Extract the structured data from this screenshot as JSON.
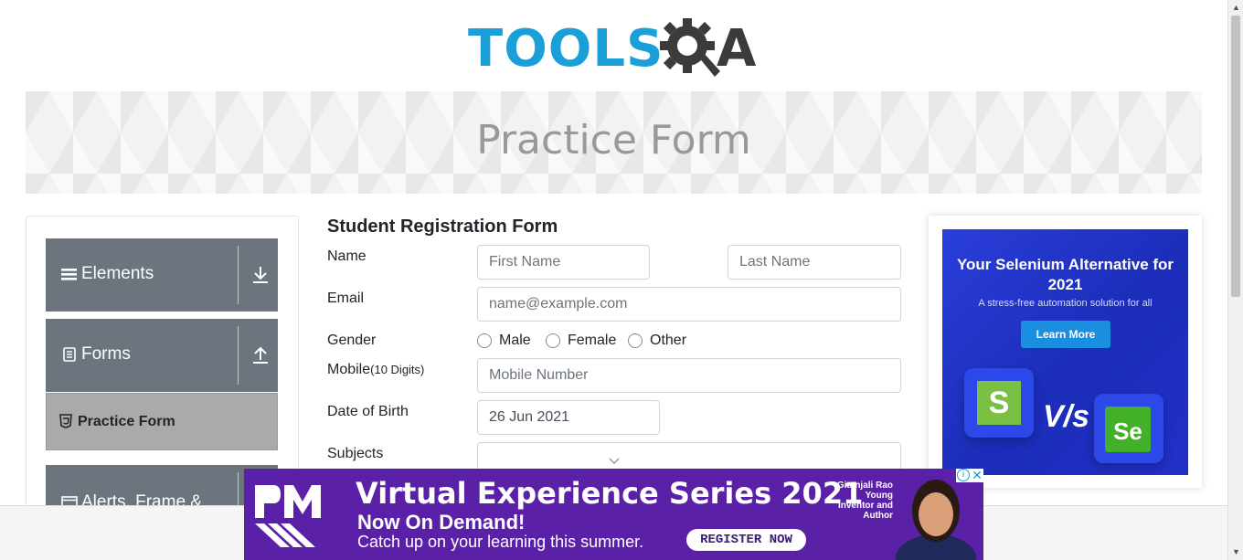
{
  "logo": {
    "text_blue": "TOOLS",
    "text_dark": "A"
  },
  "banner": {
    "title": "Practice Form"
  },
  "sidebar": {
    "groups": [
      {
        "label": "Elements",
        "icon": "hamburger-icon",
        "arrow": "download-icon"
      },
      {
        "label": "Forms",
        "icon": "document-icon",
        "arrow": "upload-icon"
      },
      {
        "label": "Alerts, Frame &",
        "icon": "window-icon",
        "arrow": ""
      }
    ],
    "active_item": {
      "label": "Practice Form",
      "icon": "html5-icon"
    }
  },
  "form": {
    "title": "Student Registration Form",
    "name_label": "Name",
    "first_name_placeholder": "First Name",
    "last_name_placeholder": "Last Name",
    "email_label": "Email",
    "email_placeholder": "name@example.com",
    "gender_label": "Gender",
    "gender_options": [
      "Male",
      "Female",
      "Other"
    ],
    "mobile_label": "Mobile",
    "mobile_hint": "(10 Digits)",
    "mobile_placeholder": "Mobile Number",
    "dob_label": "Date of Birth",
    "dob_value": "26 Jun 2021",
    "subjects_label": "Subjects"
  },
  "ad_right": {
    "headline": "Your Selenium Alternative for 2021",
    "subline": "A stress-free automation solution for all",
    "button": "Learn More",
    "tile_left": "S",
    "vs": "V/s",
    "tile_right": "Se"
  },
  "ad_bottom": {
    "line1": "Virtual Experience Series 2021",
    "line2": "Now On Demand!",
    "line3": "Catch up on your learning this summer.",
    "button": "REGISTER NOW",
    "person_name": "Gitanjali Rao",
    "person_title": "Young Inventor and Author",
    "info_glyph": "i",
    "close_glyph": "✕"
  },
  "colors": {
    "brand_blue": "#1a9fd9",
    "sidebar_gray": "#6c757d",
    "ad_purple": "#5b20a8",
    "ad_blue": "#2a3edb"
  }
}
